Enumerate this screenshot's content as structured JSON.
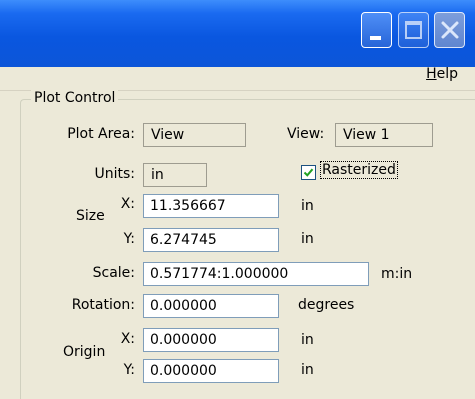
{
  "window": {
    "buttons": {
      "minimize": "minimize-icon",
      "maximize": "maximize-icon",
      "close": "close-icon"
    }
  },
  "menubar": {
    "help_accel": "H",
    "help_rest": "elp"
  },
  "plot_control": {
    "group_label": "Plot Control",
    "plot_area_label": "Plot Area:",
    "plot_area_value": "View",
    "view_label": "View:",
    "view_value": "View 1",
    "units_label": "Units:",
    "units_value": "in",
    "rasterized_checked": true,
    "rasterized_label": "Rasterized",
    "size_label": "Size",
    "size_x_label": "X:",
    "size_x_value": "11.356667",
    "size_x_unit": "in",
    "size_y_label": "Y:",
    "size_y_value": "6.274745",
    "size_y_unit": "in",
    "scale_label": "Scale:",
    "scale_value": "0.571774:1.000000",
    "scale_unit": "m:in",
    "rotation_label": "Rotation:",
    "rotation_value": "0.000000",
    "rotation_unit": "degrees",
    "origin_label": "Origin",
    "origin_x_label": "X:",
    "origin_x_value": "0.000000",
    "origin_x_unit": "in",
    "origin_y_label": "Y:",
    "origin_y_value": "0.000000",
    "origin_y_unit": "in"
  }
}
